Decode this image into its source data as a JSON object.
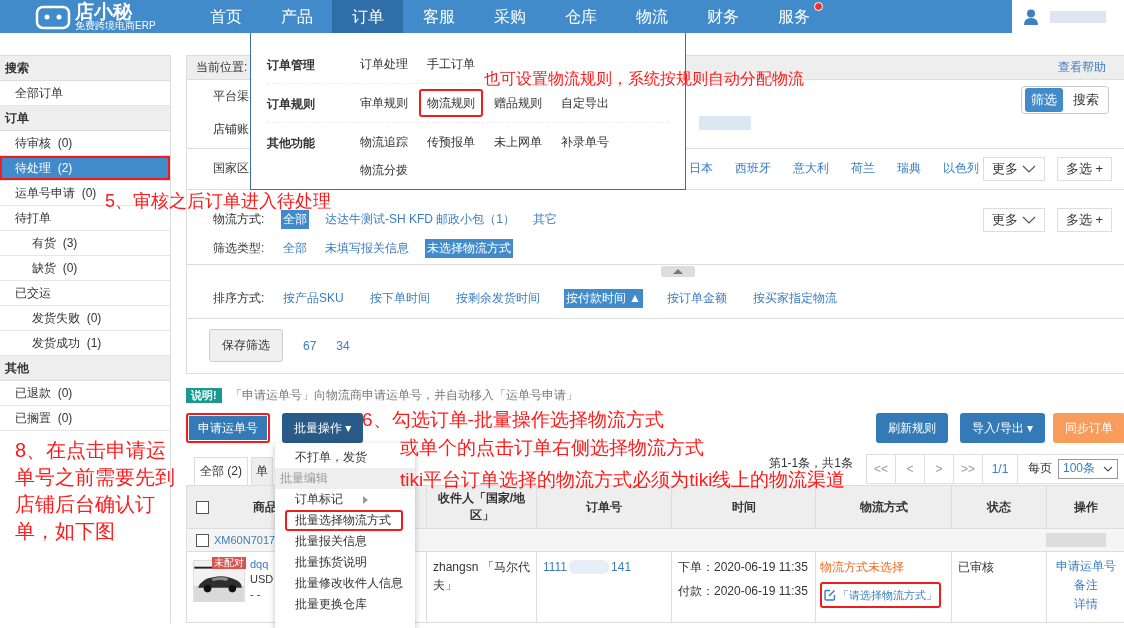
{
  "header": {
    "logo_name": "店小秘",
    "logo_tagline": "免费跨境电商ERP",
    "nav": [
      {
        "label": "首页",
        "selected": false,
        "dot": false
      },
      {
        "label": "产品",
        "selected": false,
        "dot": false
      },
      {
        "label": "订单",
        "selected": true,
        "dot": false
      },
      {
        "label": "客服",
        "selected": false,
        "dot": false
      },
      {
        "label": "采购",
        "selected": false,
        "dot": false
      },
      {
        "label": "仓库",
        "selected": false,
        "dot": false
      },
      {
        "label": "物流",
        "selected": false,
        "dot": false
      },
      {
        "label": "财务",
        "selected": false,
        "dot": false
      },
      {
        "label": "服务",
        "selected": false,
        "dot": true
      }
    ]
  },
  "nav_menu": {
    "groups": [
      {
        "title": "订单管理",
        "items": [
          {
            "label": "订单处理",
            "highlighted": false
          },
          {
            "label": "手工订单",
            "highlighted": false
          }
        ]
      },
      {
        "title": "订单规则",
        "items": [
          {
            "label": "审单规则",
            "highlighted": false
          },
          {
            "label": "物流规则",
            "highlighted": true
          },
          {
            "label": "赠品规则",
            "highlighted": false
          },
          {
            "label": "自定导出",
            "highlighted": false
          }
        ]
      },
      {
        "title": "其他功能",
        "items": [
          {
            "label": "物流追踪",
            "highlighted": false
          },
          {
            "label": "传预报单",
            "highlighted": false
          },
          {
            "label": "未上网单",
            "highlighted": false
          },
          {
            "label": "补录单号",
            "highlighted": false
          },
          {
            "label": "物流分拨",
            "highlighted": false
          }
        ]
      }
    ]
  },
  "sidebar": {
    "sections": [
      {
        "title": "搜索",
        "items": [
          {
            "label": "全部订单",
            "selected": false,
            "highlighted": false
          }
        ]
      },
      {
        "title": "订单",
        "items": [
          {
            "label": "待审核",
            "count": "(0)",
            "selected": false,
            "highlighted": false
          },
          {
            "label": "待处理",
            "count": "(2)",
            "selected": true,
            "highlighted": true
          },
          {
            "label": "运单号申请",
            "count": "(0)",
            "selected": false,
            "highlighted": false
          },
          {
            "label": "待打单",
            "selected": false,
            "highlighted": false,
            "children": [
              {
                "label": "有货",
                "count": "(3)",
                "selected": false,
                "highlighted": false
              },
              {
                "label": "缺货",
                "count": "(0)",
                "selected": false,
                "highlighted": false
              }
            ]
          },
          {
            "label": "已交运",
            "selected": false,
            "highlighted": false,
            "children": [
              {
                "label": "发货失败",
                "count": "(0)",
                "selected": false,
                "highlighted": false
              },
              {
                "label": "发货成功",
                "count": "(1)",
                "selected": false,
                "highlighted": false
              }
            ]
          }
        ]
      },
      {
        "title": "其他",
        "items": [
          {
            "label": "已退款",
            "count": "(0)",
            "selected": false,
            "highlighted": false
          },
          {
            "label": "已搁置",
            "count": "(0)",
            "selected": false,
            "highlighted": false
          }
        ]
      }
    ]
  },
  "breadcrumb": {
    "label": "当前位置:",
    "help": "查看帮助"
  },
  "filters": {
    "hidden_labels": [
      "平台渠",
      "店铺账"
    ],
    "view_toggle": [
      {
        "label": "筛选",
        "selected": true
      },
      {
        "label": "搜索",
        "selected": false
      }
    ],
    "rows": [
      {
        "kind": "country",
        "label": "国家区",
        "options": [
          {
            "label": "日本",
            "selected": false
          },
          {
            "label": "西班牙",
            "selected": false
          },
          {
            "label": "意大利",
            "selected": false
          },
          {
            "label": "荷兰",
            "selected": false
          },
          {
            "label": "瑞典",
            "selected": false
          },
          {
            "label": "以色列",
            "selected": false
          }
        ],
        "more": "更多",
        "multi": "多选 +"
      },
      {
        "kind": "plain",
        "label": "物流方式:",
        "options": [
          {
            "label": "全部",
            "selected": true
          },
          {
            "label": "达达牛测试-SH KFD 邮政小包（1）",
            "selected": false
          },
          {
            "label": "其它",
            "selected": false
          }
        ],
        "more": "更多",
        "multi": "多选 +"
      },
      {
        "kind": "plain",
        "label": "筛选类型:",
        "options": [
          {
            "label": "全部",
            "selected": false
          },
          {
            "label": "未填写报关信息",
            "selected": false
          },
          {
            "label": "未选择物流方式",
            "selected": true
          }
        ]
      }
    ],
    "sort": {
      "label": "排序方式:",
      "options": [
        {
          "label": "按产品SKU",
          "selected": false
        },
        {
          "label": "按下单时间",
          "selected": false
        },
        {
          "label": "按剩余发货时间",
          "selected": false
        },
        {
          "label": "按付款时间 ▲",
          "selected": true
        },
        {
          "label": "按订单金额",
          "selected": false
        },
        {
          "label": "按买家指定物流",
          "selected": false
        }
      ]
    },
    "save_button": "保存筛选",
    "saved": [
      "67",
      "34"
    ]
  },
  "notice": {
    "badge": "说明!",
    "text": "「申请运单号」向物流商申请运单号，并自动移入「运单号申请」"
  },
  "actions": {
    "left": [
      {
        "label": "申请运单号",
        "kind": "primary",
        "highlighted": true
      },
      {
        "label": "批量操作 ▾",
        "kind": "dark",
        "highlighted": false
      }
    ],
    "right": [
      {
        "label": "刷新规则",
        "kind": "primary",
        "highlighted": false
      },
      {
        "label": "导入/导出 ▾",
        "kind": "primary",
        "highlighted": false
      },
      {
        "label": "同步订单",
        "kind": "warning",
        "highlighted": false
      }
    ]
  },
  "tabs": [
    {
      "label": "全部 (2)",
      "selected": true
    },
    {
      "label": "单",
      "selected": false
    }
  ],
  "pagination": {
    "summary": "第1-1条，共1条",
    "buttons": [
      "<<",
      "<",
      ">",
      ">>"
    ],
    "page": "1/1",
    "per_page_label": "每页",
    "per_page": "100条"
  },
  "table": {
    "select_all_checked": false,
    "columns": [
      "商品",
      "收件人「国家/地区」",
      "订单号",
      "时间",
      "物流方式",
      "状态",
      "操作"
    ],
    "groups": [
      {
        "order_id": "XM60N7017",
        "checked": false,
        "rows": [
          {
            "badge": "未配对",
            "product": "dqq",
            "price": "USD",
            "note": "- -",
            "recipient": "zhangsn 「马尔代夫」",
            "order_no_start": "1111",
            "order_no_end": "141",
            "times": [
              "下单：2020-06-19 11:35",
              "付款：2020-06-19 11:35"
            ],
            "shipping_status": "物流方式未选择",
            "shipping_action": "「请选择物流方式」",
            "shipping_highlighted": true,
            "status": "已审核",
            "operations": [
              "申请运单号",
              "备注",
              "详情"
            ]
          }
        ]
      }
    ]
  },
  "batch_menu": {
    "items": [
      {
        "kind": "item",
        "label": "不打单，发货",
        "highlighted": false
      },
      {
        "kind": "header",
        "label": "批量编辑"
      },
      {
        "kind": "submenu",
        "label": "订单标记",
        "highlighted": false
      },
      {
        "kind": "item",
        "label": "批量选择物流方式",
        "highlighted": true
      },
      {
        "kind": "item",
        "label": "批量报关信息",
        "highlighted": false
      },
      {
        "kind": "item",
        "label": "批量拣货说明",
        "highlighted": false
      },
      {
        "kind": "item",
        "label": "批量修改收件人信息",
        "highlighted": false
      },
      {
        "kind": "item",
        "label": "批量更换仓库",
        "highlighted": false
      }
    ]
  },
  "annotations": [
    {
      "text": "也可设置物流规则，系统按规则自动分配物流"
    },
    {
      "text": "5、审核之后订单进入待处理"
    },
    {
      "text": "6、勾选订单-批量操作选择物流方式"
    },
    {
      "text": "或单个的点击订单右侧选择物流方式"
    },
    {
      "text": "tiki平台订单选择的物流方式必须为tiki线上的物流渠道"
    },
    {
      "text": "8、在点击申请运单号之前需要先到店铺后台确认订单，如下图"
    }
  ]
}
